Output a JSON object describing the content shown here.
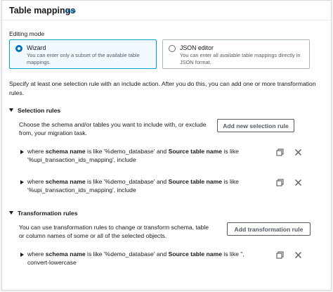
{
  "header": {
    "title": "Table mappings",
    "info": "Info"
  },
  "editing_mode": {
    "label": "Editing mode",
    "options": [
      {
        "title": "Wizard",
        "desc": "You can enter only a subset of the available table mappings.",
        "selected": true
      },
      {
        "title": "JSON editor",
        "desc": "You can enter all available table mappings directly in JSON format.",
        "selected": false
      }
    ]
  },
  "instruction": "Specify at least one selection rule with an include action. After you do this, you can add one or more transformation rules.",
  "selection": {
    "title": "Selection rules",
    "desc": "Choose the schema and/or tables you want to include with, or exclude from, your migration task.",
    "add_button": "Add new selection rule",
    "rules": [
      {
        "p1": "where ",
        "k1": "schema name",
        "p2": " is like '%demo_database' and ",
        "k2": "Source table name",
        "p3": " is like '%upi_transaction_ids_mapping', include"
      },
      {
        "p1": "where ",
        "k1": "schema name",
        "p2": " is like '%demo_database' and ",
        "k2": "Source table name",
        "p3": " is like '%upi_transaction_ids_mapping', include"
      }
    ]
  },
  "transformation": {
    "title": "Transformation rules",
    "desc": "You can use transformation rules to change or transform schema, table or column names of some or all of the selected objects.",
    "add_button": "Add transformation rule",
    "rules": [
      {
        "p1": "where ",
        "k1": "schema name",
        "p2": " is like '%demo_database' and ",
        "k2": "Source table name",
        "p3": " is like '', convert-lowercase"
      }
    ]
  }
}
